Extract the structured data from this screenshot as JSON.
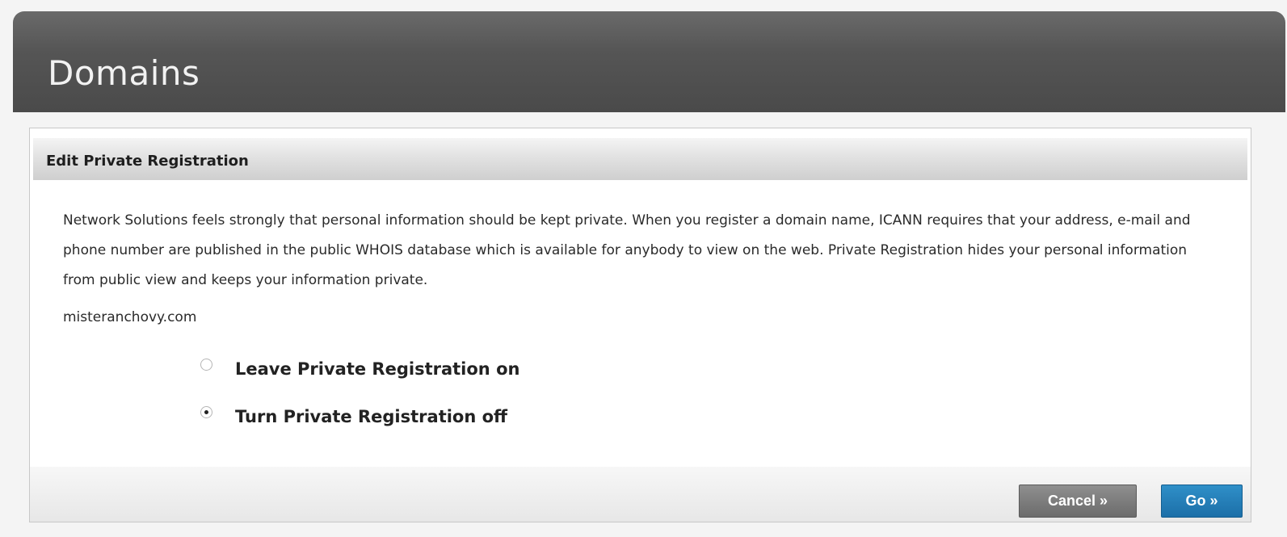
{
  "header": {
    "title": "Domains"
  },
  "panel": {
    "title": "Edit Private Registration",
    "description": "Network Solutions feels strongly that personal information should be kept private. When you register a domain name, ICANN requires that your address, e-mail and phone number are published in the public WHOIS database which is available for anybody to view on the web. Private Registration hides your personal information from public view and keeps your information private.",
    "domain": "misteranchovy.com",
    "options": [
      {
        "label": "Leave Private Registration on",
        "selected": false
      },
      {
        "label": "Turn Private Registration off",
        "selected": true
      }
    ]
  },
  "buttons": {
    "cancel_label": "Cancel »",
    "go_label": "Go »"
  },
  "colors": {
    "header_bg": "#555555",
    "go_button": "#1c6fa8",
    "cancel_button": "#6b6b6b"
  }
}
